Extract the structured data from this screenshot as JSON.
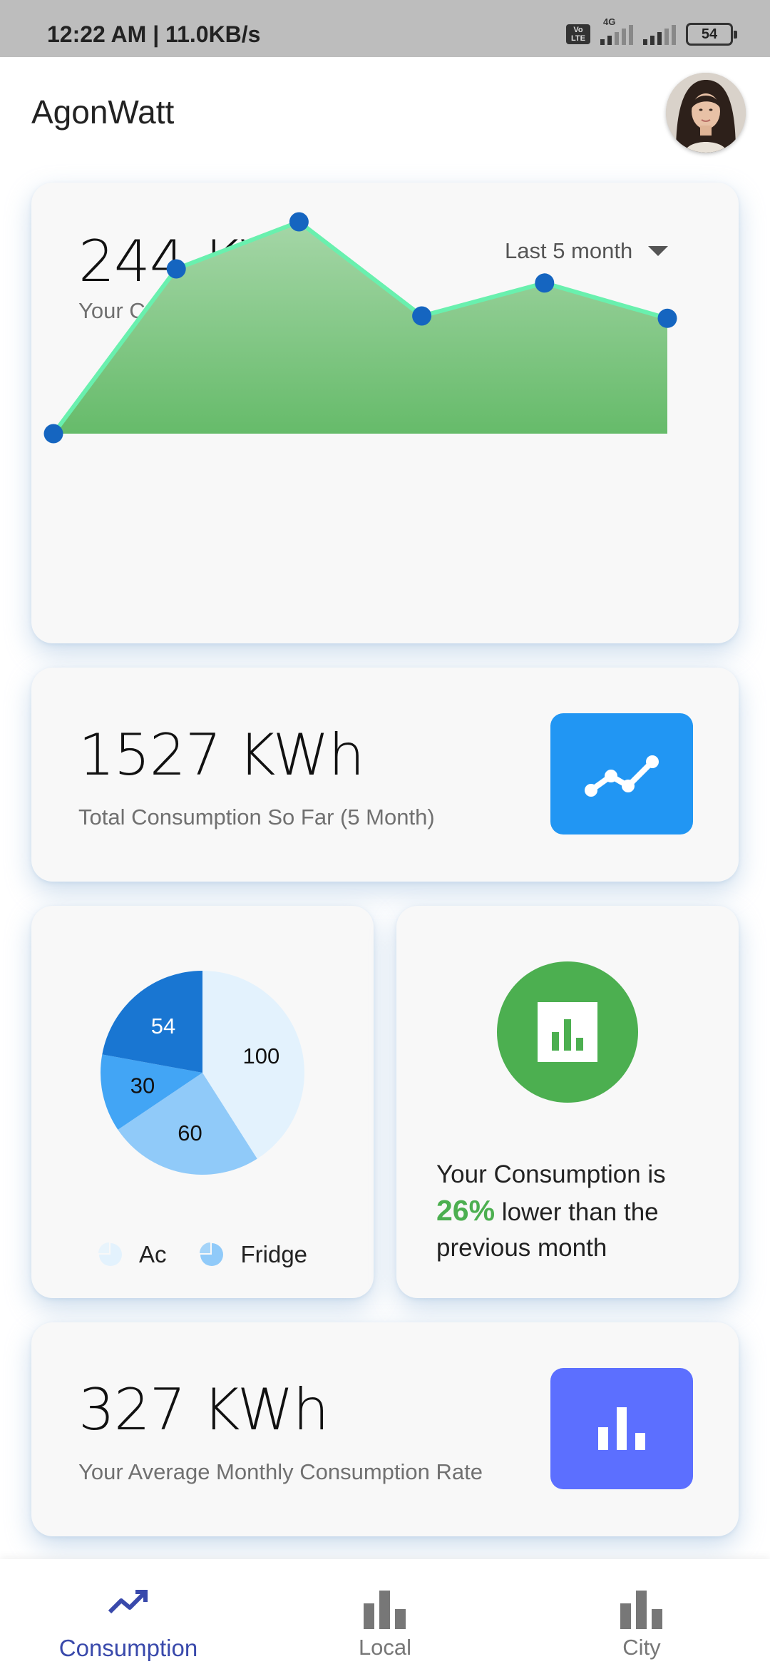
{
  "status_bar": {
    "time_speed": "12:22 AM | 11.0KB/s",
    "volte": "Vo LTE",
    "network": "4G",
    "battery": "54"
  },
  "app_bar": {
    "title": "AgonWatt"
  },
  "consumption_card": {
    "value": "244 KWh",
    "label": "Your Consumption",
    "period_select": "Last 5 month",
    "colors": {
      "fill_top": "#a5d6a7",
      "fill_bottom": "#66bb6a",
      "line": "#69f0ae",
      "point": "#1565c0"
    }
  },
  "chart_data": {
    "type": "area",
    "title": "",
    "xlabel": "",
    "ylabel": "",
    "x": [
      0,
      1,
      2,
      3,
      4,
      5
    ],
    "values": [
      0,
      70,
      90,
      50,
      64,
      49
    ],
    "ylim": [
      0,
      100
    ],
    "grid": false
  },
  "total_card": {
    "value": "1527 KWh",
    "label": "Total Consumption So Far (5 Month)",
    "icon": "trending-up-icon",
    "color": "#2196f3"
  },
  "pie_card": {
    "slices": [
      {
        "label": "100",
        "value": 100,
        "color": "#e3f2fd"
      },
      {
        "label": "60",
        "value": 60,
        "color": "#90caf9"
      },
      {
        "label": "30",
        "value": 30,
        "color": "#42a5f5"
      },
      {
        "label": "54",
        "value": 54,
        "color": "#1976d2"
      }
    ],
    "legend": [
      {
        "label": "Ac",
        "color": "#e3f2fd"
      },
      {
        "label": "Fridge",
        "color": "#90caf9"
      }
    ]
  },
  "comparison_card": {
    "icon": "bar-chart-icon",
    "color": "#4caf50",
    "text_before": "Your Consumption is",
    "percent": "26%",
    "text_after": " lower than the previous month"
  },
  "average_card": {
    "value": "327 KWh",
    "label": "Your Average Monthly Consumption Rate",
    "icon": "bar-chart-icon",
    "color": "#5c6fff"
  },
  "bottom_nav": {
    "items": [
      {
        "label": "Consumption",
        "icon": "trending-up-icon",
        "active": true
      },
      {
        "label": "Local",
        "icon": "bar-chart-icon",
        "active": false
      },
      {
        "label": "City",
        "icon": "bar-chart-icon",
        "active": false
      }
    ]
  }
}
